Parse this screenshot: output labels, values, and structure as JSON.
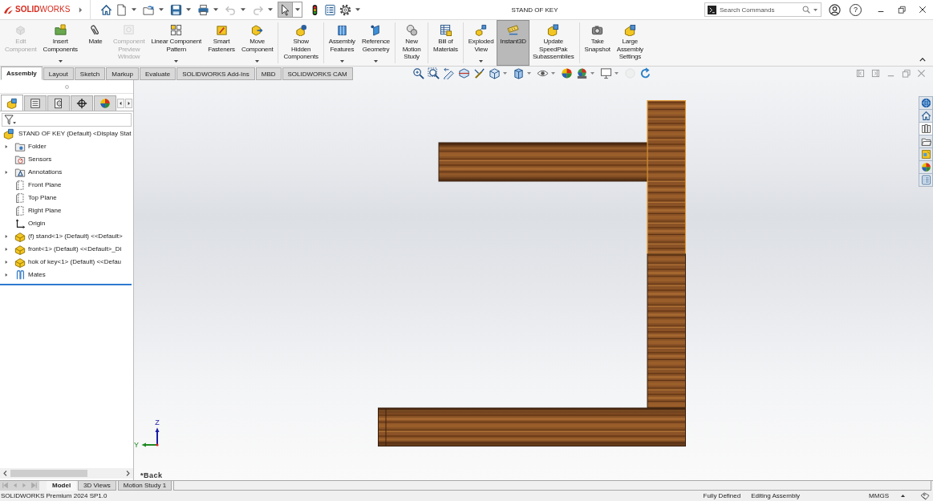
{
  "app": {
    "logo": "**SOLID**WORKS"
  },
  "window": {
    "title": "STAND OF KEY",
    "help": "?"
  },
  "quick_access": [
    {
      "kind": "home",
      "menu": false,
      "selected": false,
      "disabled": false
    },
    {
      "kind": "new",
      "menu": true,
      "selected": false,
      "disabled": false
    },
    {
      "kind": "open",
      "menu": true,
      "selected": false,
      "disabled": false
    },
    {
      "kind": "save",
      "menu": true,
      "selected": false,
      "disabled": false
    },
    {
      "kind": "print",
      "menu": true,
      "selected": false,
      "disabled": false
    },
    {
      "kind": "undo",
      "menu": true,
      "selected": false,
      "disabled": true
    },
    {
      "kind": "redo",
      "menu": true,
      "selected": false,
      "disabled": true
    },
    {
      "kind": "select",
      "menu": true,
      "selected": true,
      "disabled": false
    },
    {
      "kind": "rebuild",
      "menu": false,
      "selected": false,
      "disabled": false
    },
    {
      "kind": "file-properties",
      "menu": false,
      "selected": false,
      "disabled": false
    },
    {
      "kind": "options",
      "menu": true,
      "selected": false,
      "disabled": false
    }
  ],
  "search": {
    "placeholder": "Search Commands"
  },
  "ribbon": {
    "groups": [
      {
        "buttons": [
          {
            "kind": "edit-component",
            "label": "Edit\nComponent",
            "menu": false,
            "selected": false,
            "disabled": true
          },
          {
            "kind": "insert-components",
            "label": "Insert\nComponents",
            "menu": true,
            "selected": false,
            "disabled": false
          },
          {
            "kind": "mate",
            "label": "Mate",
            "menu": false,
            "selected": false,
            "disabled": false
          },
          {
            "kind": "component-preview",
            "label": "Component\nPreview\nWindow",
            "menu": false,
            "selected": false,
            "disabled": true
          },
          {
            "kind": "linear-pattern",
            "label": "Linear Component\nPattern",
            "menu": true,
            "selected": false,
            "disabled": false
          },
          {
            "kind": "smart-fasteners",
            "label": "Smart\nFasteners",
            "menu": false,
            "selected": false,
            "disabled": false
          },
          {
            "kind": "move-component",
            "label": "Move\nComponent",
            "menu": true,
            "selected": false,
            "disabled": false
          }
        ]
      },
      {
        "buttons": [
          {
            "kind": "show-hidden",
            "label": "Show\nHidden\nComponents",
            "menu": false,
            "selected": false,
            "disabled": false
          }
        ]
      },
      {
        "buttons": [
          {
            "kind": "assembly-features",
            "label": "Assembly\nFeatures",
            "menu": true,
            "selected": false,
            "disabled": false
          },
          {
            "kind": "reference-geometry",
            "label": "Reference\nGeometry",
            "menu": true,
            "selected": false,
            "disabled": false
          }
        ]
      },
      {
        "buttons": [
          {
            "kind": "motion-study",
            "label": "New\nMotion\nStudy",
            "menu": false,
            "selected": false,
            "disabled": false
          }
        ]
      },
      {
        "buttons": [
          {
            "kind": "bom",
            "label": "Bill of\nMaterials",
            "menu": false,
            "selected": false,
            "disabled": false
          }
        ]
      },
      {
        "buttons": [
          {
            "kind": "exploded-view",
            "label": "Exploded\nView",
            "menu": true,
            "selected": false,
            "disabled": false
          },
          {
            "kind": "instant3d",
            "label": "Instant3D",
            "menu": false,
            "selected": true,
            "disabled": false
          },
          {
            "kind": "speedpak",
            "label": "Update\nSpeedPak\nSubassemblies",
            "menu": false,
            "selected": false,
            "disabled": false
          }
        ]
      },
      {
        "buttons": [
          {
            "kind": "snapshot",
            "label": "Take\nSnapshot",
            "menu": false,
            "selected": false,
            "disabled": false
          },
          {
            "kind": "large-assembly",
            "label": "Large\nAssembly\nSettings",
            "menu": false,
            "selected": false,
            "disabled": false
          }
        ]
      }
    ]
  },
  "tabs": [
    {
      "label": "Assembly",
      "selected": true
    },
    {
      "label": "Layout",
      "selected": false
    },
    {
      "label": "Sketch",
      "selected": false
    },
    {
      "label": "Markup",
      "selected": false
    },
    {
      "label": "Evaluate",
      "selected": false
    },
    {
      "label": "SOLIDWORKS Add-Ins",
      "selected": false
    },
    {
      "label": "MBD",
      "selected": false
    },
    {
      "label": "SOLIDWORKS CAM",
      "selected": false
    }
  ],
  "feature_manager": {
    "tabs": [
      {
        "kind": "feature-tree",
        "selected": true
      },
      {
        "kind": "property-manager",
        "selected": false
      },
      {
        "kind": "configuration-manager",
        "selected": false
      },
      {
        "kind": "dimxpert",
        "selected": false
      },
      {
        "kind": "display-manager",
        "selected": false
      }
    ],
    "tree": {
      "kind": "assembly",
      "label": "STAND OF KEY (Default) <Display Stat",
      "children": [
        {
          "kind": "folder",
          "label": "Folder",
          "expanded": false
        },
        {
          "kind": "sensors",
          "label": "Sensors"
        },
        {
          "kind": "annotations",
          "label": "Annotations",
          "expanded": false
        },
        {
          "kind": "plane",
          "label": "Front Plane"
        },
        {
          "kind": "plane",
          "label": "Top Plane"
        },
        {
          "kind": "plane",
          "label": "Right Plane"
        },
        {
          "kind": "origin",
          "label": "Origin"
        },
        {
          "kind": "part",
          "label": "(f) stand<1> (Default) <<Default>",
          "expanded": false
        },
        {
          "kind": "part",
          "label": "front<1> (Default) <<Default>_Di",
          "expanded": false
        },
        {
          "kind": "part",
          "label": "hok of key<1> (Default) <<Defau",
          "expanded": false
        },
        {
          "kind": "mates",
          "label": "Mates",
          "expanded": false
        }
      ]
    }
  },
  "viewport": {
    "view_name": "*Back",
    "triad": [
      {
        "kind": "vertical",
        "label": "Z",
        "color": "#1c1ca8"
      },
      {
        "kind": "horizontal",
        "label": "Y",
        "color": "#1f8a22"
      }
    ]
  },
  "task_pane": [
    {
      "kind": "resources",
      "selected": false
    },
    {
      "kind": "home",
      "selected": false
    },
    {
      "kind": "design-library",
      "selected": true
    },
    {
      "kind": "file-explorer",
      "selected": false
    },
    {
      "kind": "view-palette",
      "selected": false
    },
    {
      "kind": "appearances",
      "selected": false
    },
    {
      "kind": "custom-properties",
      "selected": false
    }
  ],
  "bottom_tabs": [
    {
      "label": "Model",
      "selected": true
    },
    {
      "label": "3D Views",
      "selected": false
    },
    {
      "label": "Motion Study 1",
      "selected": false
    }
  ],
  "status_bar": {
    "product": "SOLIDWORKS Premium 2024 SP1.0",
    "definition": "Fully Defined",
    "mode": "Editing Assembly",
    "units": "MMGS"
  }
}
